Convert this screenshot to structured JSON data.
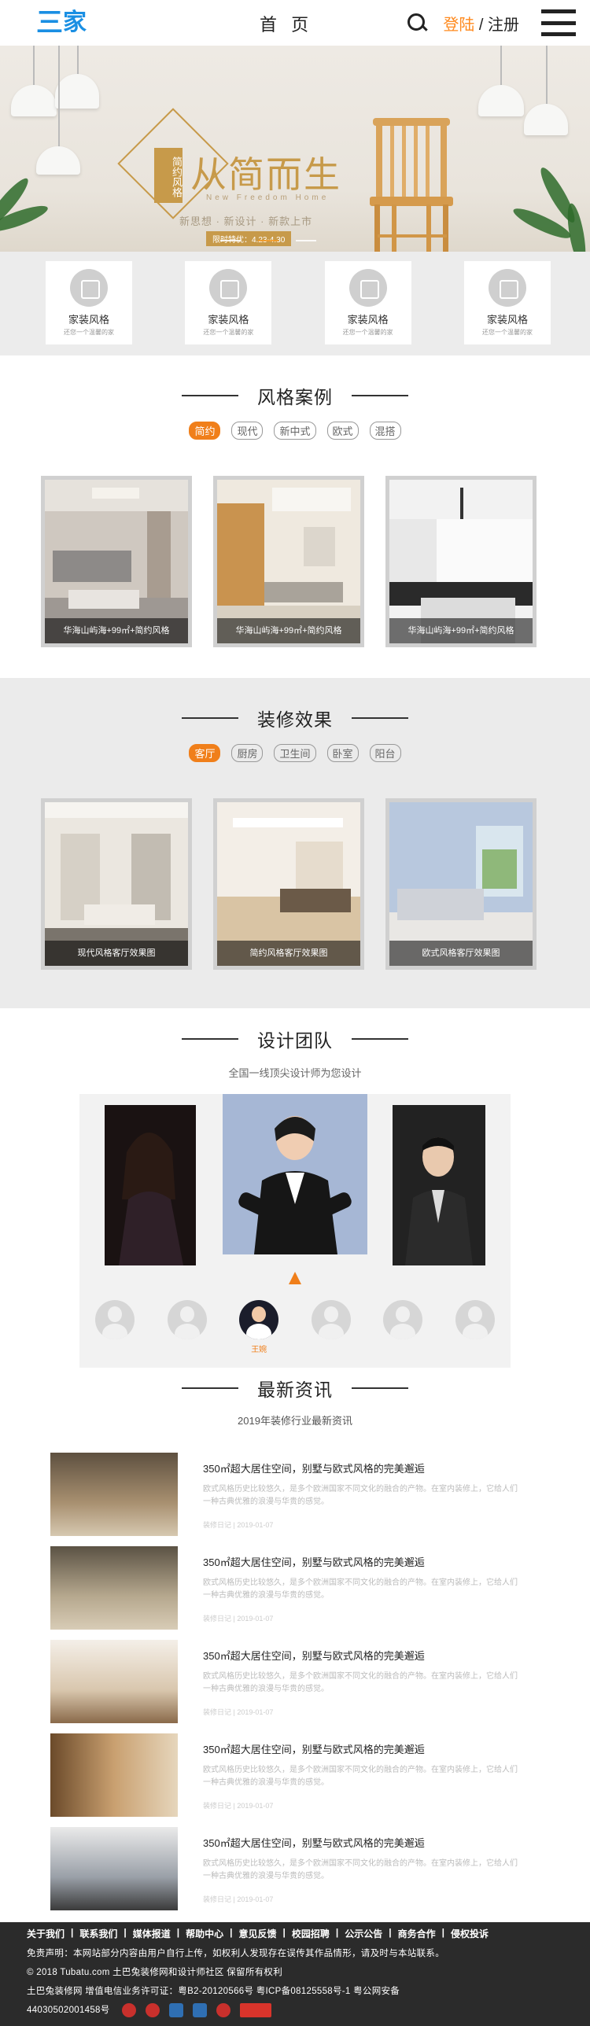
{
  "header": {
    "logo_mark": "三",
    "logo_text": "家",
    "home_label": "首 页",
    "login_label": "登陆",
    "divider": " / ",
    "register_label": "注册"
  },
  "banner": {
    "badge": "简约风格",
    "slogan": "从简而生",
    "english": "New Freedom Home",
    "subline": "新思想 · 新设计 · 新款上市",
    "limited": "限时特优：4.23-4.30"
  },
  "quick": [
    {
      "title": "家装风格",
      "sub": "还您一个温馨的家"
    },
    {
      "title": "家装风格",
      "sub": "还您一个温馨的家"
    },
    {
      "title": "家装风格",
      "sub": "还您一个温馨的家"
    },
    {
      "title": "家装风格",
      "sub": "还您一个温馨的家"
    }
  ],
  "styles": {
    "title": "风格案例",
    "tags": [
      "简约",
      "现代",
      "新中式",
      "欧式",
      "混搭"
    ],
    "cards": [
      {
        "caption": "华海山屿海+99㎡+简约风格"
      },
      {
        "caption": "华海山屿海+99㎡+简约风格"
      },
      {
        "caption": "华海山屿海+99㎡+简约风格"
      }
    ]
  },
  "effects": {
    "title": "装修效果",
    "tags": [
      "客厅",
      "厨房",
      "卫生间",
      "卧室",
      "阳台"
    ],
    "cards": [
      {
        "caption": "现代风格客厅效果图"
      },
      {
        "caption": "简约风格客厅效果图"
      },
      {
        "caption": "欧式风格客厅效果图"
      }
    ]
  },
  "team": {
    "title": "设计团队",
    "subtitle": "全国一线顶尖设计师为您设计",
    "members": [
      "",
      "",
      "王婉",
      "",
      "",
      ""
    ]
  },
  "news": {
    "title": "最新资讯",
    "subtitle": "2019年装修行业最新资讯",
    "items": [
      {
        "title": "350㎡超大居住空间，别墅与欧式风格的完美邂逅",
        "desc": "欧式风格历史比较悠久，是多个欧洲国家不同文化的融合的产物。在室内装修上，它给人们一种古典优雅的浪漫与华贵的感觉。",
        "date": "装修日记 | 2019-01-07"
      },
      {
        "title": "350㎡超大居住空间，别墅与欧式风格的完美邂逅",
        "desc": "欧式风格历史比较悠久，是多个欧洲国家不同文化的融合的产物。在室内装修上，它给人们一种古典优雅的浪漫与华贵的感觉。",
        "date": "装修日记 | 2019-01-07"
      },
      {
        "title": "350㎡超大居住空间，别墅与欧式风格的完美邂逅",
        "desc": "欧式风格历史比较悠久，是多个欧洲国家不同文化的融合的产物。在室内装修上，它给人们一种古典优雅的浪漫与华贵的感觉。",
        "date": "装修日记 | 2019-01-07"
      },
      {
        "title": "350㎡超大居住空间，别墅与欧式风格的完美邂逅",
        "desc": "欧式风格历史比较悠久，是多个欧洲国家不同文化的融合的产物。在室内装修上，它给人们一种古典优雅的浪漫与华贵的感觉。",
        "date": "装修日记 | 2019-01-07"
      },
      {
        "title": "350㎡超大居住空间，别墅与欧式风格的完美邂逅",
        "desc": "欧式风格历史比较悠久，是多个欧洲国家不同文化的融合的产物。在室内装修上，它给人们一种古典优雅的浪漫与华贵的感觉。",
        "date": "装修日记 | 2019-01-07"
      }
    ]
  },
  "footer": {
    "links": [
      "关于我们",
      "联系我们",
      "媒体报道",
      "帮助中心",
      "意见反馈",
      "校园招聘",
      "公示公告",
      "商务合作",
      "侵权投诉"
    ],
    "disclaimer": "免责声明：本网站部分内容由用户自行上传，如权利人发现存在误传其作品情形，请及时与本站联系。",
    "copyright": "© 2018 Tubatu.com 土巴兔装修网和设计师社区 保留所有权利",
    "license": "土巴兔装修网   增值电信业务许可证：粤B2-20120566号   粤ICP备08125558号-1 粤公网安备",
    "record": "44030502001458号"
  },
  "colors": {
    "accent": "#f07f1a",
    "brand": "#1a8fe3",
    "footer_bg": "#2b2b2b"
  }
}
